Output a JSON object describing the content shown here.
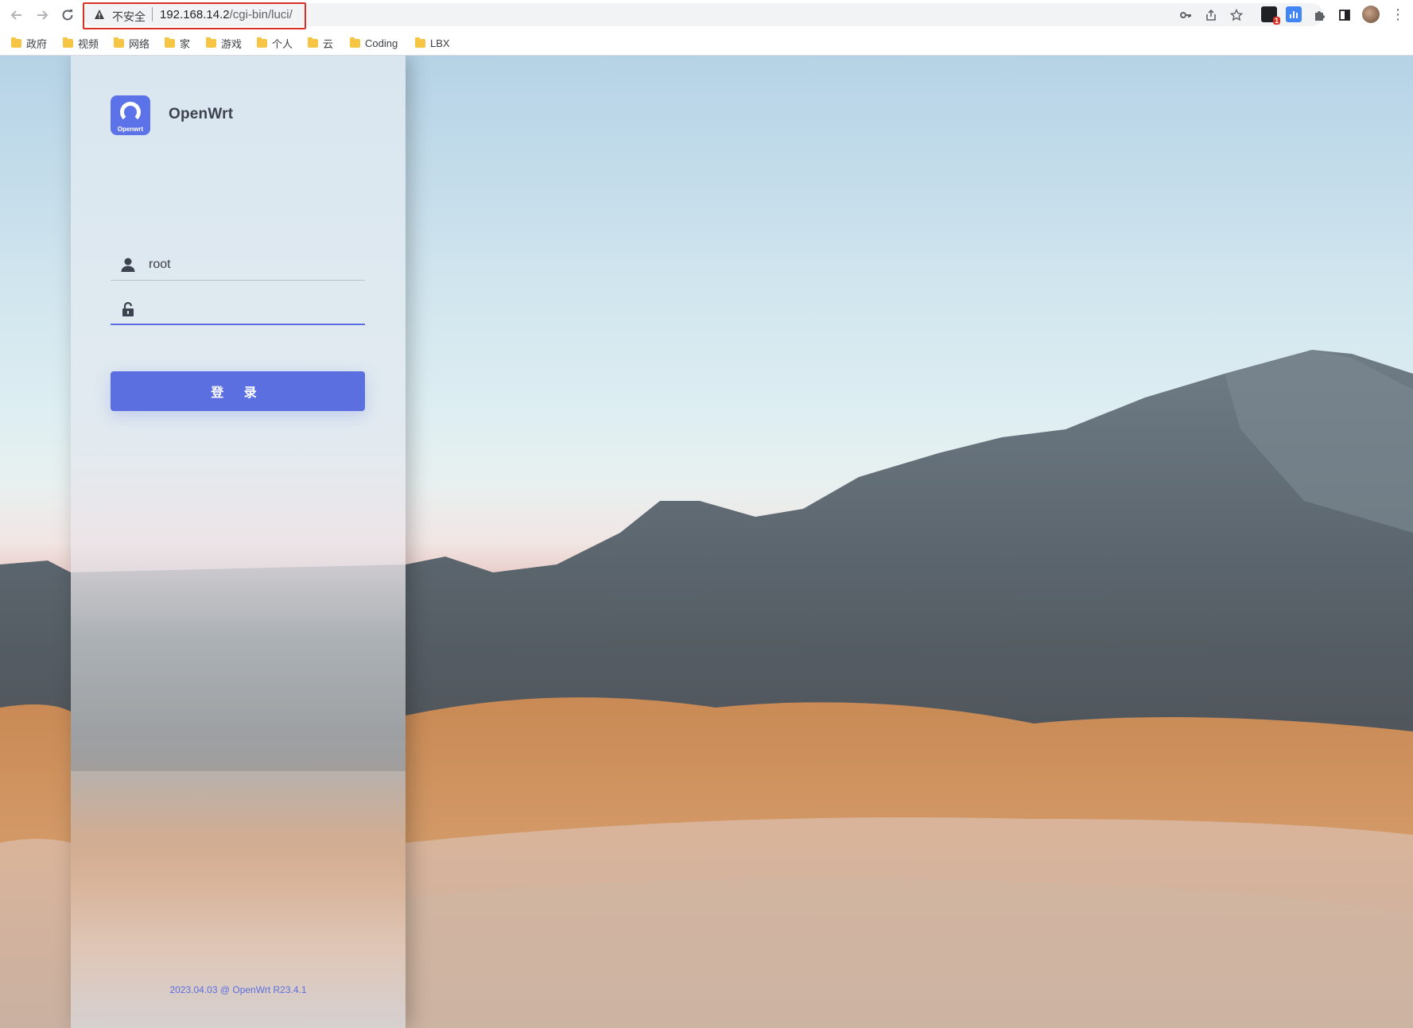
{
  "browser": {
    "insecure_label": "不安全",
    "url_host": "192.168.14.2",
    "url_path": "/cgi-bin/luci/",
    "extension_badge": "1",
    "bookmarks": [
      {
        "label": "政府"
      },
      {
        "label": "视频"
      },
      {
        "label": "网络"
      },
      {
        "label": "家"
      },
      {
        "label": "游戏"
      },
      {
        "label": "个人"
      },
      {
        "label": "云"
      },
      {
        "label": "Coding"
      },
      {
        "label": "LBX"
      }
    ]
  },
  "login": {
    "logo_text": "Openwrt",
    "brand": "OpenWrt",
    "username_value": "root",
    "password_value": "",
    "button_label": "登 录",
    "footer": "2023.04.03 @ OpenWrt R23.4.1",
    "accent_color": "#5b6fe0"
  }
}
